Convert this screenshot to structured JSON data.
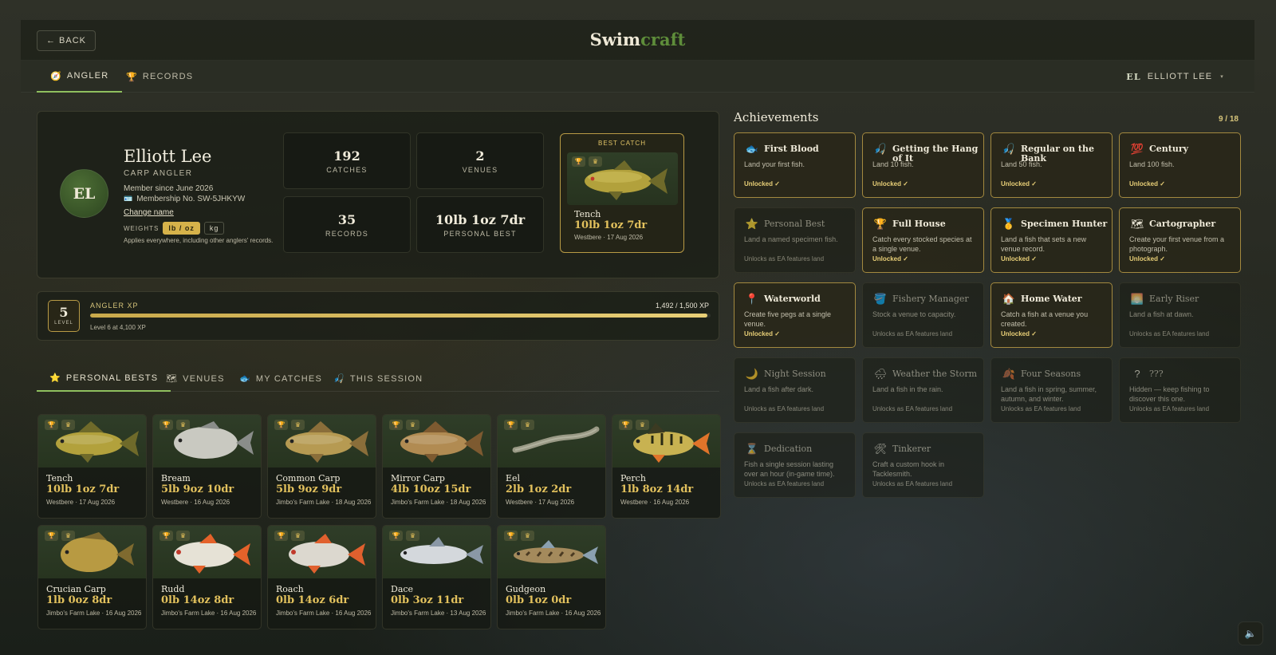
{
  "header": {
    "back_label": "← BACK",
    "logo_part1": "Swim",
    "logo_part2": "craft"
  },
  "nav": {
    "tabs": [
      {
        "icon": "🧭",
        "label": "ANGLER",
        "active": true
      },
      {
        "icon": "🏆",
        "label": "RECORDS",
        "active": false
      }
    ],
    "user_initials": "EL",
    "user_name": "ELLIOTT LEE",
    "caret": "▾"
  },
  "profile": {
    "initials": "EL",
    "name": "Elliott Lee",
    "role": "CARP ANGLER",
    "member_since": "Member since June 2026",
    "membership_icon": "🪪",
    "membership_no": "Membership No. SW-5JHKYW",
    "change_name": "Change name",
    "weights_label": "WEIGHTS",
    "weight_opt1": "lb / oz",
    "weight_opt2": "kg",
    "applies": "Applies everywhere, including other anglers' records.",
    "stats": [
      {
        "value": "192",
        "label": "CATCHES"
      },
      {
        "value": "2",
        "label": "VENUES"
      },
      {
        "value": "35",
        "label": "RECORDS"
      },
      {
        "value": "10lb 1oz 7dr",
        "label": "PERSONAL BEST"
      }
    ],
    "best_catch": {
      "header": "BEST CATCH",
      "fish": "Tench",
      "weight": "10lb 1oz 7dr",
      "meta": "Westbere · 17 Aug 2026"
    }
  },
  "xp": {
    "level": "5",
    "level_label": "LEVEL",
    "label": "ANGLER XP",
    "current": "1,492 / 1,500 XP",
    "progress": 0.995,
    "next": "Level 6 at 4,100 XP"
  },
  "subtabs": [
    {
      "icon": "⭐",
      "label": "PERSONAL BESTS",
      "active": true
    },
    {
      "icon": "🗺",
      "label": "VENUES",
      "active": false
    },
    {
      "icon": "🐟",
      "label": "MY CATCHES",
      "active": false
    },
    {
      "icon": "🎣",
      "label": "THIS SESSION",
      "active": false
    }
  ],
  "fish": [
    {
      "name": "Tench",
      "weight": "10lb 1oz 7dr",
      "meta": "Westbere · 17 Aug 2026",
      "body": "#b2a13c",
      "fin": "#6f6a2a",
      "shape": "tench"
    },
    {
      "name": "Bream",
      "weight": "5lb 9oz 10dr",
      "meta": "Westbere · 16 Aug 2026",
      "body": "#c9c9c1",
      "fin": "#8a8d8a",
      "shape": "bream"
    },
    {
      "name": "Common Carp",
      "weight": "5lb 9oz 9dr",
      "meta": "Jimbo's Farm Lake · 18 Aug 2026",
      "body": "#b69a52",
      "fin": "#8a6e3a",
      "shape": "carp"
    },
    {
      "name": "Mirror Carp",
      "weight": "4lb 10oz 15dr",
      "meta": "Jimbo's Farm Lake · 18 Aug 2026",
      "body": "#b18b52",
      "fin": "#7d5a30",
      "shape": "carp"
    },
    {
      "name": "Eel",
      "weight": "2lb 1oz 2dr",
      "meta": "Westbere · 17 Aug 2026",
      "body": "#9a9a86",
      "fin": "#6a6a5a",
      "shape": "eel"
    },
    {
      "name": "Perch",
      "weight": "1lb 8oz 14dr",
      "meta": "Westbere · 16 Aug 2026",
      "body": "#c8b251",
      "fin": "#e0742a",
      "shape": "perch"
    },
    {
      "name": "Crucian Carp",
      "weight": "1lb 0oz 8dr",
      "meta": "Jimbo's Farm Lake · 16 Aug 2026",
      "body": "#b89a42",
      "fin": "#7f6a2f",
      "shape": "crucian"
    },
    {
      "name": "Rudd",
      "weight": "0lb 14oz 8dr",
      "meta": "Jimbo's Farm Lake · 16 Aug 2026",
      "body": "#e6e2d6",
      "fin": "#e4622a",
      "shape": "roach"
    },
    {
      "name": "Roach",
      "weight": "0lb 14oz 6dr",
      "meta": "Jimbo's Farm Lake · 16 Aug 2026",
      "body": "#dcd8cf",
      "fin": "#e0602e",
      "shape": "roach"
    },
    {
      "name": "Dace",
      "weight": "0lb 3oz 11dr",
      "meta": "Jimbo's Farm Lake · 13 Aug 2026",
      "body": "#d4d8dc",
      "fin": "#8a98a6",
      "shape": "dace"
    },
    {
      "name": "Gudgeon",
      "weight": "0lb 1oz 0dr",
      "meta": "Jimbo's Farm Lake · 16 Aug 2026",
      "body": "#a48a5c",
      "fin": "#8aa0b0",
      "shape": "gudgeon"
    }
  ],
  "achievements": {
    "title": "Achievements",
    "count": "9 / 18",
    "items": [
      {
        "icon": "🐟",
        "title": "First Blood",
        "desc": "Land your first fish.",
        "status": "Unlocked ✓",
        "unlocked": true
      },
      {
        "icon": "🎣",
        "title": "Getting the Hang of It",
        "desc": "Land 10 fish.",
        "status": "Unlocked ✓",
        "unlocked": true
      },
      {
        "icon": "🎣",
        "title": "Regular on the Bank",
        "desc": "Land 50 fish.",
        "status": "Unlocked ✓",
        "unlocked": true
      },
      {
        "icon": "💯",
        "title": "Century",
        "desc": "Land 100 fish.",
        "status": "Unlocked ✓",
        "unlocked": true
      },
      {
        "icon": "⭐",
        "title": "Personal Best",
        "desc": "Land a named specimen fish.",
        "status": "Unlocks as EA features land",
        "unlocked": false
      },
      {
        "icon": "🏆",
        "title": "Full House",
        "desc": "Catch every stocked species at a single venue.",
        "status": "Unlocked ✓",
        "unlocked": true
      },
      {
        "icon": "🥇",
        "title": "Specimen Hunter",
        "desc": "Land a fish that sets a new venue record.",
        "status": "Unlocked ✓",
        "unlocked": true
      },
      {
        "icon": "🗺",
        "title": "Cartographer",
        "desc": "Create your first venue from a photograph.",
        "status": "Unlocked ✓",
        "unlocked": true
      },
      {
        "icon": "📍",
        "title": "Waterworld",
        "desc": "Create five pegs at a single venue.",
        "status": "Unlocked ✓",
        "unlocked": true
      },
      {
        "icon": "🪣",
        "title": "Fishery Manager",
        "desc": "Stock a venue to capacity.",
        "status": "Unlocks as EA features land",
        "unlocked": false
      },
      {
        "icon": "🏠",
        "title": "Home Water",
        "desc": "Catch a fish at a venue you created.",
        "status": "Unlocked ✓",
        "unlocked": true
      },
      {
        "icon": "🌅",
        "title": "Early Riser",
        "desc": "Land a fish at dawn.",
        "status": "Unlocks as EA features land",
        "unlocked": false
      },
      {
        "icon": "🌙",
        "title": "Night Session",
        "desc": "Land a fish after dark.",
        "status": "Unlocks as EA features land",
        "unlocked": false
      },
      {
        "icon": "🌧",
        "title": "Weather the Storm",
        "desc": "Land a fish in the rain.",
        "status": "Unlocks as EA features land",
        "unlocked": false
      },
      {
        "icon": "🍂",
        "title": "Four Seasons",
        "desc": "Land a fish in spring, summer, autumn, and winter.",
        "status": "Unlocks as EA features land",
        "unlocked": false
      },
      {
        "icon": "?",
        "title": "???",
        "desc": "Hidden — keep fishing to discover this one.",
        "status": "Unlocks as EA features land",
        "unlocked": false
      },
      {
        "icon": "⌛",
        "title": "Dedication",
        "desc": "Fish a single session lasting over an hour (in-game time).",
        "status": "Unlocks as EA features land",
        "unlocked": false
      },
      {
        "icon": "🛠",
        "title": "Tinkerer",
        "desc": "Craft a custom hook in Tacklesmith.",
        "status": "Unlocks as EA features land",
        "unlocked": false
      }
    ]
  },
  "sound_icon": "🔈"
}
